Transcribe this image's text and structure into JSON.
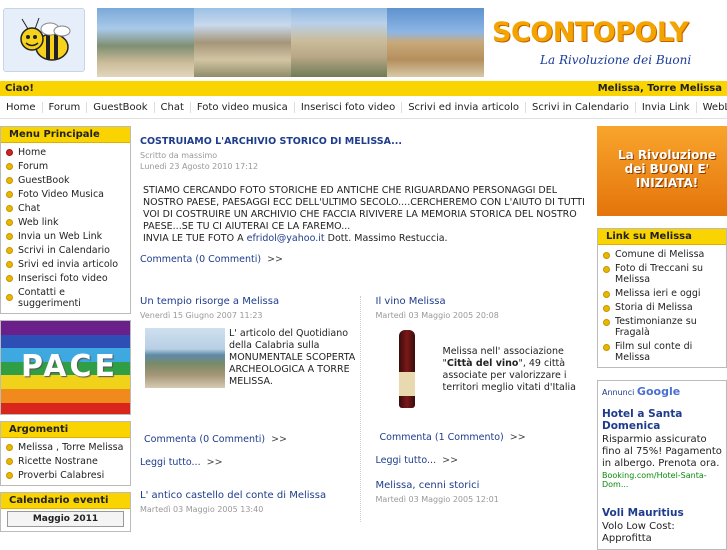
{
  "site": {
    "logo_title": "SCONTOPOLY",
    "logo_tagline": "La Rivoluzione dei Buoni"
  },
  "welcome": {
    "greeting": "Ciao!",
    "location": "Melissa, Torre Melissa"
  },
  "nav": [
    "Home",
    "Forum",
    "GuestBook",
    "Chat",
    "Foto video musica",
    "Inserisci foto video",
    "Scrivi ed invia articolo",
    "Scrivi in Calendario",
    "Invia Link",
    "WebLink"
  ],
  "menu": {
    "title": "Menu Principale",
    "items": [
      "Home",
      "Forum",
      "GuestBook",
      "Foto Video Musica",
      "Chat",
      "Web link",
      "Invia un Web Link",
      "Scrivi in Calendario",
      "Srivi ed invia articolo",
      "Inserisci foto video",
      "Contatti e suggerimenti"
    ]
  },
  "pace": {
    "text": "PACE"
  },
  "argomenti": {
    "title": "Argomenti",
    "items": [
      "Melissa , Torre Melissa",
      "Ricette Nostrane",
      "Proverbi Calabresi"
    ]
  },
  "calendario": {
    "title": "Calendario eventi",
    "month": "Maggio 2011"
  },
  "main_article": {
    "title": "COSTRUIAMO L'ARCHIVIO STORICO DI MELISSA...",
    "author": "Scritto da massimo",
    "date": "Lunedì 23 Agosto 2010 17:12",
    "body": "STIAMO CERCANDO FOTO STORICHE ED ANTICHE CHE RIGUARDANO PERSONAGGI DEL NOSTRO PAESE, PAESAGGI ECC DELL'ULTIMO SECOLO....CERCHEREMO CON L'AIUTO DI TUTTI VOI DI COSTRUIRE UN ARCHIVIO CHE FACCIA RIVIVERE LA MEMORIA STORICA DEL NOSTRO PAESE...SE TU CI AIUTERAI CE LA FAREMO...",
    "send_prefix": "INVIA LE TUE FOTO A ",
    "email": "efridol@yahoo.it",
    "send_suffix": " Dott. Massimo Restuccia.",
    "comments": "Commenta (0 Commenti)",
    "arrow": ">>"
  },
  "articles": [
    {
      "title": "Un tempio risorge a Melissa",
      "date": "Venerdì 15 Giugno 2007 11:23",
      "body": "L' articolo del Quotidiano della Calabria sulla MONUMENTALE SCOPERTA ARCHEOLOGICA A TORRE MELISSA.",
      "comments": "Commenta (0 Commenti)",
      "read_more": "Leggi tutto...",
      "arrow": ">>"
    },
    {
      "title": "Il vino Melissa",
      "date": "Martedì 03 Maggio 2005 20:08",
      "body_prefix": "Melissa nell' associazione \"",
      "body_bold": "Città del vino",
      "body_suffix": "\", 49 città associate per valorizzare i territori meglio vitati d'Italia",
      "comments": "Commenta (1 Commento)",
      "read_more": "Leggi tutto...",
      "arrow": ">>"
    }
  ],
  "bottom_articles": [
    {
      "title": "L' antico castello del conte di Melissa",
      "date": "Martedì 03 Maggio 2005 13:40"
    },
    {
      "title": "Melissa, cenni storici",
      "date": "Martedì 03 Maggio 2005 12:01"
    }
  ],
  "promo": {
    "text": "La Rivoluzione dei BUONI E' INIZIATA!"
  },
  "links": {
    "title": "Link su Melissa",
    "items": [
      "Comune di Melissa",
      "Foto di Treccani su Melissa",
      "Melissa ieri e oggi",
      "Storia di Melissa",
      "Testimonianze su Fragalà",
      "Film sul conte di Melissa"
    ]
  },
  "ads": {
    "label": "Annunci",
    "brand": "Google",
    "items": [
      {
        "title": "Hotel a Santa Domenica",
        "text": "Risparmio assicurato fino al 75%! Pagamento in albergo. Prenota ora.",
        "url": "Booking.com/Hotel-Santa-Dom..."
      },
      {
        "title": "Voli Mauritius",
        "text": "Volo Low Cost: Approfitta"
      }
    ]
  },
  "colors": {
    "accent_yellow": "#f9d400",
    "link_blue": "#1e3c8c",
    "logo_orange": "#f4a400"
  }
}
